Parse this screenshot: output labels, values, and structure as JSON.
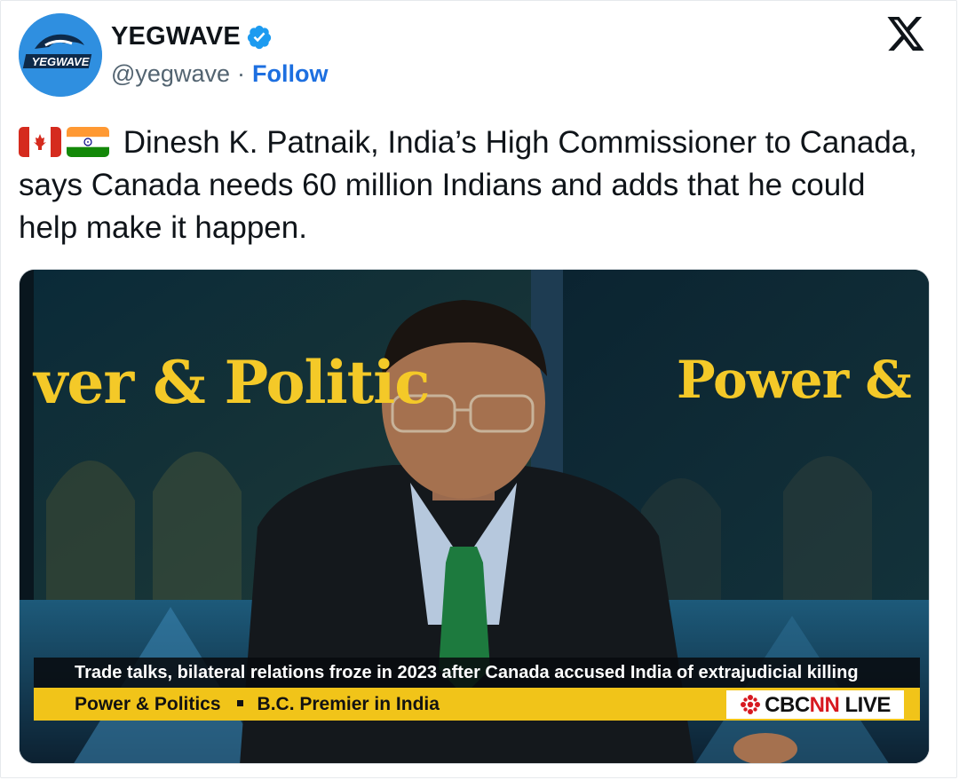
{
  "header": {
    "display_name": "YEGWAVE",
    "handle": "@yegwave",
    "separator": "·",
    "follow_label": "Follow",
    "avatar_text": "YEGWAVE"
  },
  "tweet": {
    "flags": [
      "canada-flag",
      "india-flag"
    ],
    "text": "Dinesh K. Patnaik, India’s High Commissioner to Canada, says Canada needs 60 million Indians and adds that he could help make it happen."
  },
  "video": {
    "show_name_left": "ver & Politic",
    "show_name_right": "Power &",
    "headline": "Trade talks, bilateral relations froze in 2023 after Canada accused India of extrajudicial killing",
    "program": "Power & Politics",
    "topic": "B.C. Premier in India",
    "network_cbc": "CBC",
    "network_nn": "NN",
    "network_live": "LIVE"
  },
  "colors": {
    "follow": "#1d6fe0",
    "verified": "#1d9bf0",
    "ticker_yellow": "#f1c419",
    "show_gold": "#f4c928"
  }
}
